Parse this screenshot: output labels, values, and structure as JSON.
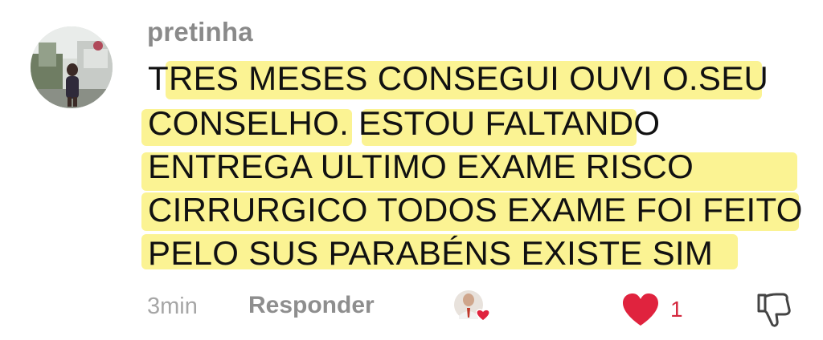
{
  "comment": {
    "username": "pretinha",
    "lines": [
      "TRES MESES CONSEGUI OUVI O.SEU",
      "CONSELHO. ESTOU FALTANDO",
      "ENTREGA ULTIMO EXAME RISCO",
      "CIRRURGICO TODOS EXAME FOI FEITO",
      "PELO SUS PARABÉNS EXISTE SIM"
    ],
    "time_ago": "3min",
    "reply_label": "Responder",
    "like_count": "1"
  },
  "colors": {
    "highlight": "#fbf28a",
    "like_red": "#e0233e",
    "username_gray": "#8a8a8a"
  },
  "icons": {
    "avatar": "user-photo",
    "liker": "creator-avatar-with-heart",
    "like": "heart-icon",
    "dislike": "thumbs-down-icon"
  }
}
